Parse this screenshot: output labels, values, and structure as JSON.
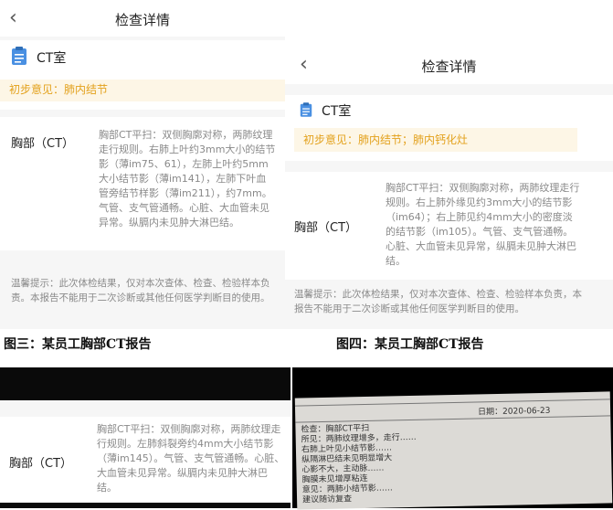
{
  "panels": [
    {
      "nav_title": "检查详情",
      "room": "CT室",
      "opinion": "初步意见：肺内结节",
      "exam_label": "胸部（CT）",
      "findings": "胸部CT平扫：双侧胸廓对称，两肺纹理走行规则。右肺上叶约3mm大小的结节影（薄im75、61），左肺上叶约5mm大小结节影（薄im141），左肺下叶血管旁结节样影（薄im211），约7mm。气管、支气管通畅。心脏、大血管未见异常。纵膈内未见肿大淋巴结。",
      "note": "温馨提示：此次体检结果，仅对本次查体、检查、检验样本负责。本报告不能用于二次诊断或其他任何医学判断目的使用。"
    },
    {
      "nav_title": "检查详情",
      "room": "CT室",
      "opinion": "初步意见：肺内结节；肺内钙化灶",
      "exam_label": "胸部（CT）",
      "findings": "胸部CT平扫：双侧胸廓对称，两肺纹理走行规则。右上肺外缘见约3mm大小的结节影（im64）；右上肺见约4mm大小的密度淡的结节影（im105）。气管、支气管通畅。心脏、大血管未见异常，纵膈未见肿大淋巴结。",
      "note": "温馨提示：此次体检结果，仅对本次查体、检查、检验样本负责，本报告不能用于二次诊断或其他任何医学判断目的使用。"
    },
    {
      "exam_label": "胸部（CT）",
      "findings": "胸部CT平扫：双侧胸廓对称，两肺纹理走行规则。左肺斜裂旁约4mm大小结节影（薄im145）。气管、支气管通畅。心脏、大血管未见异常。纵膈内未见肿大淋巴结。"
    }
  ],
  "captions": {
    "fig3": "图三：某员工胸部CT报告",
    "fig4": "图四：某员工胸部CT报告"
  },
  "photo": {
    "date": "日期：2020-06-23",
    "lines": [
      "检查：胸部CT平扫",
      "所见：两肺纹理增多，走行……",
      "右肺上叶见小结节影……",
      "纵隔淋巴结未见明显增大",
      "心影不大，主动脉……",
      "胸膜未见增厚粘连",
      "意见：两肺小结节影……",
      "建议随访复查"
    ]
  },
  "colors": {
    "accent": "#e3a11c",
    "opinion_bg": "#fdf6e6",
    "icon_blue": "#4a90e2"
  },
  "icons": {
    "back": "chevron-left-icon",
    "room": "clipboard-icon"
  }
}
